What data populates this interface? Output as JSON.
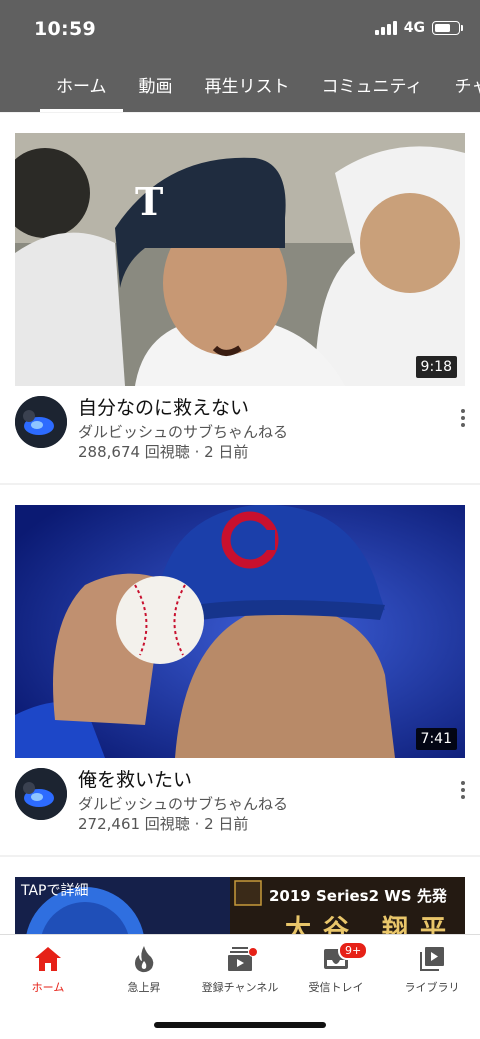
{
  "status_bar": {
    "time": "10:59",
    "network": "4G"
  },
  "tabs": [
    {
      "label": "ホーム",
      "active": true
    },
    {
      "label": "動画"
    },
    {
      "label": "再生リスト"
    },
    {
      "label": "コミュニティ"
    },
    {
      "label": "チャンネル"
    }
  ],
  "videos": [
    {
      "title": "自分なのに救えない",
      "channel": "ダルビッシュのサブちゃんねる",
      "stats": "288,674 回視聴 · 2 日前",
      "duration": "9:18",
      "thumb_icon": "crying-pitcher-thumbnail"
    },
    {
      "title": "俺を救いたい",
      "channel": "ダルビッシュのサブちゃんねる",
      "stats": "272,461 回視聴 · 2 日前",
      "duration": "7:41",
      "thumb_icon": "cubs-pitcher-thumbnail"
    }
  ],
  "promo_banner": {
    "tap_text": "TAPで詳細",
    "title_text": "2019 Series2 WS 先発",
    "big_text": "大谷 翔平"
  },
  "bottom_nav": [
    {
      "label": "ホーム",
      "icon": "home-icon",
      "active": true
    },
    {
      "label": "急上昇",
      "icon": "trending-flame-icon"
    },
    {
      "label": "登録チャンネル",
      "icon": "subscriptions-icon"
    },
    {
      "label": "受信トレイ",
      "icon": "inbox-icon",
      "badge": "9+"
    },
    {
      "label": "ライブラリ",
      "icon": "library-icon"
    }
  ],
  "colors": {
    "accent": "#e62117",
    "header": "#606060",
    "background": "#f1f1f1"
  }
}
